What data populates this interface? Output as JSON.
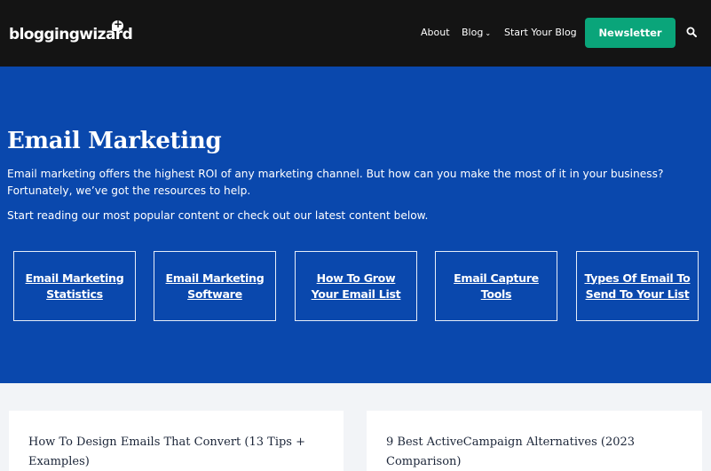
{
  "header": {
    "logo_text": "bloggingwizard",
    "nav": {
      "about": "About",
      "blog": "Blog",
      "start": "Start Your Blog"
    },
    "newsletter_label": "Newsletter"
  },
  "hero": {
    "title": "Email Marketing",
    "paragraph_1": "Email marketing offers the highest ROI of any marketing channel. But how can you make the most of it in your business? Fortunately, we’ve got the resources to help.",
    "paragraph_2": "Start reading our most popular content or check out our latest content below.",
    "cards": [
      {
        "line1": "Email Marketing",
        "line2": "Statistics"
      },
      {
        "line1": "Email Marketing",
        "line2": "Software"
      },
      {
        "line1": "How To Grow",
        "line2": "Your Email List"
      },
      {
        "line1": "Email Capture",
        "line2": "Tools"
      },
      {
        "line1": "Types Of Email To",
        "line2": "Send To Your List"
      }
    ]
  },
  "posts": [
    {
      "title": "How To Design Emails That Convert (13 Tips + Examples)"
    },
    {
      "title": "9 Best ActiveCampaign Alternatives (2023 Comparison)"
    }
  ],
  "colors": {
    "header_bg": "#141414",
    "hero_bg": "#0a48ad",
    "accent_green": "#0aa57a"
  }
}
